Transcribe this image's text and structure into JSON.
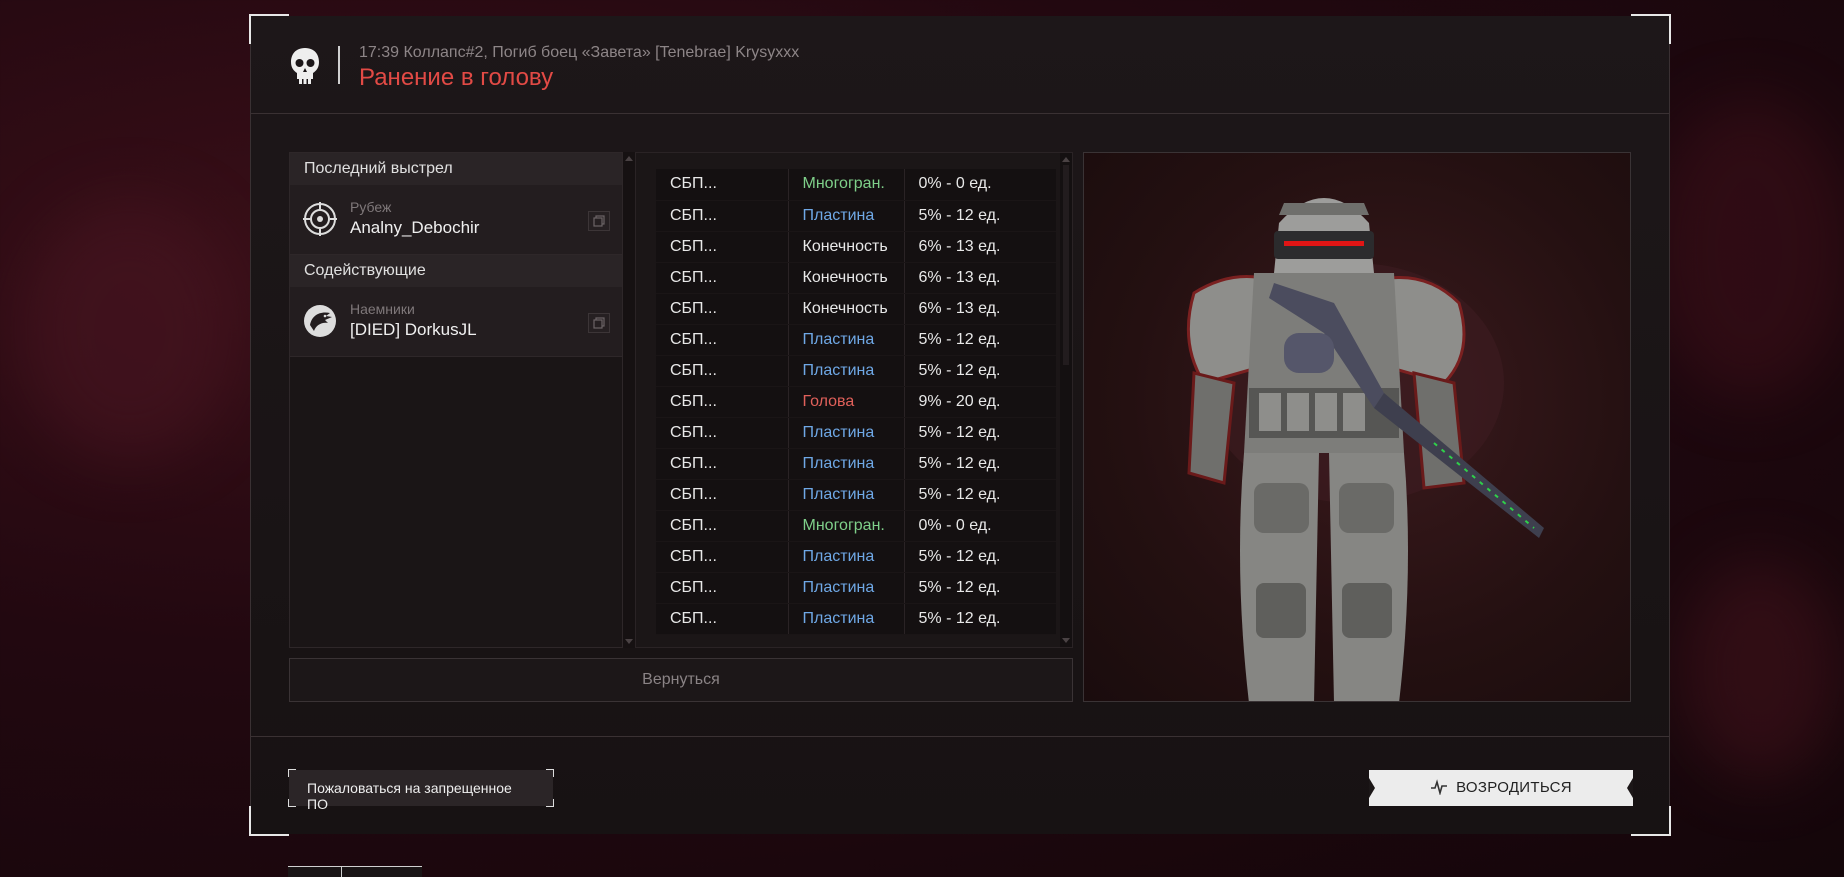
{
  "header": {
    "subtitle": "17:39 Коллапс#2, Погиб боец «Завета» [Tenebrae] Krysyxxx",
    "title": "Ранение в голову",
    "icon": "skull-icon"
  },
  "left_panel": {
    "last_shot_heading": "Последний выстрел",
    "killer": {
      "faction": "Рубеж",
      "name": "Analny_Debochir",
      "icon": "crosshair-emblem-icon"
    },
    "assists_heading": "Содействующие",
    "assist": {
      "faction": "Наемники",
      "name": "[DIED] DorkusJL",
      "icon": "eagle-emblem-icon"
    }
  },
  "hits_table": {
    "rows": [
      {
        "weapon": "СБП...",
        "zone": "Многогран.",
        "damage": "0% - 0 ед.",
        "zone_type": "multi"
      },
      {
        "weapon": "СБП...",
        "zone": "Пластина",
        "damage": "5% - 12 ед.",
        "zone_type": "plate"
      },
      {
        "weapon": "СБП...",
        "zone": "Конечность",
        "damage": "6% - 13 ед.",
        "zone_type": "limb"
      },
      {
        "weapon": "СБП...",
        "zone": "Конечность",
        "damage": "6% - 13 ед.",
        "zone_type": "limb"
      },
      {
        "weapon": "СБП...",
        "zone": "Конечность",
        "damage": "6% - 13 ед.",
        "zone_type": "limb"
      },
      {
        "weapon": "СБП...",
        "zone": "Пластина",
        "damage": "5% - 12 ед.",
        "zone_type": "plate"
      },
      {
        "weapon": "СБП...",
        "zone": "Пластина",
        "damage": "5% - 12 ед.",
        "zone_type": "plate"
      },
      {
        "weapon": "СБП...",
        "zone": "Голова",
        "damage": "9% - 20 ед.",
        "zone_type": "head"
      },
      {
        "weapon": "СБП...",
        "zone": "Пластина",
        "damage": "5% - 12 ед.",
        "zone_type": "plate"
      },
      {
        "weapon": "СБП...",
        "zone": "Пластина",
        "damage": "5% - 12 ед.",
        "zone_type": "plate"
      },
      {
        "weapon": "СБП...",
        "zone": "Пластина",
        "damage": "5% - 12 ед.",
        "zone_type": "plate"
      },
      {
        "weapon": "СБП...",
        "zone": "Многогран.",
        "damage": "0% - 0 ед.",
        "zone_type": "multi"
      },
      {
        "weapon": "СБП...",
        "zone": "Пластина",
        "damage": "5% - 12 ед.",
        "zone_type": "plate"
      },
      {
        "weapon": "СБП...",
        "zone": "Пластина",
        "damage": "5% - 12 ед.",
        "zone_type": "plate"
      },
      {
        "weapon": "СБП...",
        "zone": "Пластина",
        "damage": "5% - 12 ед.",
        "zone_type": "plate"
      }
    ]
  },
  "zone_colors": {
    "multi": "#7fd08a",
    "plate": "#6fa8e6",
    "limb": "#e8e8e8",
    "head": "#e0605a"
  },
  "back_button": "Вернуться",
  "footer": {
    "report_button": "Пожаловаться на запрещенное ПО",
    "respawn_button": "ВОЗРОДИТЬСЯ",
    "respawn_icon": "pulse-icon"
  }
}
